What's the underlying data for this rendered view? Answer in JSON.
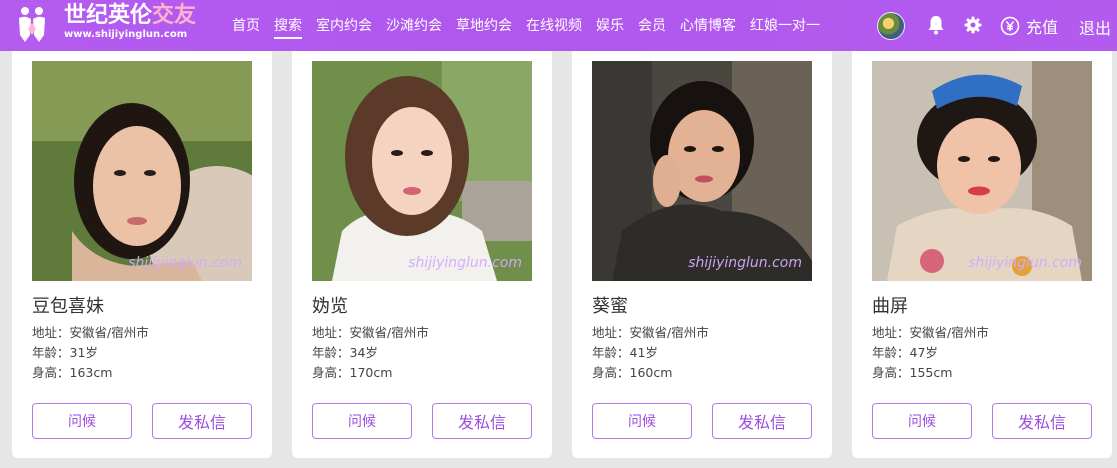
{
  "header": {
    "logo_title_main": "世纪英伦",
    "logo_title_accent": "交友",
    "logo_url": "www.shijiyinglun.com",
    "nav": [
      {
        "label": "首页",
        "active": false
      },
      {
        "label": "搜索",
        "active": true
      },
      {
        "label": "室内约会",
        "active": false
      },
      {
        "label": "沙滩约会",
        "active": false
      },
      {
        "label": "草地约会",
        "active": false
      },
      {
        "label": "在线视频",
        "active": false
      },
      {
        "label": "娱乐",
        "active": false
      },
      {
        "label": "会员",
        "active": false
      },
      {
        "label": "心情博客",
        "active": false
      },
      {
        "label": "红娘一对一",
        "active": false
      }
    ],
    "recharge_label": "充值",
    "logout_label": "退出"
  },
  "watermark": "shijiyinglun.com",
  "profiles": [
    {
      "name": "豆包喜妹",
      "address": "地址：安徽省/宿州市",
      "age": "年龄：31岁",
      "height": "身高：163cm",
      "greet_label": "问候",
      "message_label": "发私信"
    },
    {
      "name": "妫览",
      "address": "地址：安徽省/宿州市",
      "age": "年龄：34岁",
      "height": "身高：170cm",
      "greet_label": "问候",
      "message_label": "发私信"
    },
    {
      "name": "葵蜜",
      "address": "地址：安徽省/宿州市",
      "age": "年龄：41岁",
      "height": "身高：160cm",
      "greet_label": "问候",
      "message_label": "发私信"
    },
    {
      "name": "曲屏",
      "address": "地址：安徽省/宿州市",
      "age": "年龄：47岁",
      "height": "身高：155cm",
      "greet_label": "问候",
      "message_label": "发私信"
    }
  ],
  "colors": {
    "header_bg": "#b057ee",
    "button_border": "#b57ae6",
    "button_text": "#9b4ee0",
    "watermark": "#d2aaff"
  },
  "icons": [
    "logo-mark-icon",
    "bell-icon",
    "gear-icon",
    "yen-coin-icon"
  ]
}
